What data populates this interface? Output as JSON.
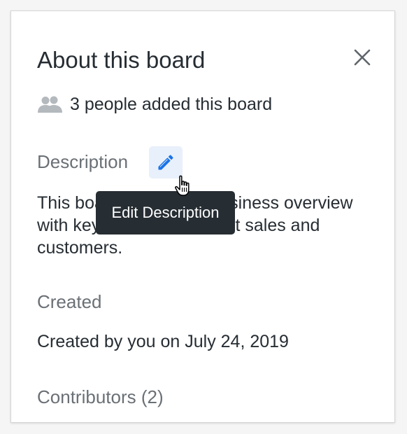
{
  "panel": {
    "title": "About this board",
    "close_icon": "close-icon",
    "people_icon": "people-icon",
    "people_text": "3 people added this board"
  },
  "description": {
    "heading": "Description",
    "edit_icon": "pencil-icon",
    "text": "This board provides a business overview with key information about sales and customers.",
    "tooltip": "Edit Description"
  },
  "created": {
    "heading": "Created",
    "text": "Created by you on July 24, 2019"
  },
  "contributors": {
    "heading": "Contributors (2)"
  },
  "colors": {
    "accent": "#1a73e8",
    "edit_button_bg": "#e8f0fb",
    "tooltip_bg": "#262d33",
    "heading_gray": "#6a7075",
    "text_dark": "#262d33"
  }
}
